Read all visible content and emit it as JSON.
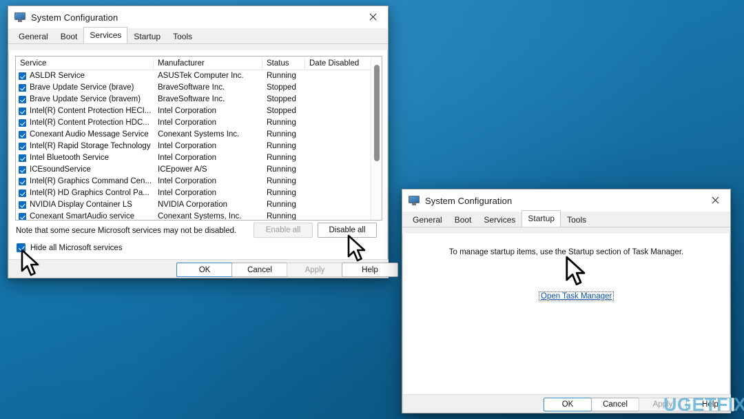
{
  "desktop": {
    "background_top": "#1d82bd",
    "background_bottom": "#0b5d8c"
  },
  "watermark": {
    "text": "UGETFIX"
  },
  "window_services": {
    "title": "System Configuration",
    "icon": "monitor-icon",
    "close_label": "✕",
    "tabs": [
      {
        "label": "General",
        "active": false
      },
      {
        "label": "Boot",
        "active": false
      },
      {
        "label": "Services",
        "active": true
      },
      {
        "label": "Startup",
        "active": false
      },
      {
        "label": "Tools",
        "active": false
      }
    ],
    "columns": [
      "Service",
      "Manufacturer",
      "Status",
      "Date Disabled"
    ],
    "rows": [
      {
        "checked": true,
        "service": "ASLDR Service",
        "manufacturer": "ASUSTek Computer Inc.",
        "status": "Running",
        "date_disabled": ""
      },
      {
        "checked": true,
        "service": "Brave Update Service (brave)",
        "manufacturer": "BraveSoftware Inc.",
        "status": "Stopped",
        "date_disabled": ""
      },
      {
        "checked": true,
        "service": "Brave Update Service (bravem)",
        "manufacturer": "BraveSoftware Inc.",
        "status": "Stopped",
        "date_disabled": ""
      },
      {
        "checked": true,
        "service": "Intel(R) Content Protection HECI...",
        "manufacturer": "Intel Corporation",
        "status": "Stopped",
        "date_disabled": ""
      },
      {
        "checked": true,
        "service": "Intel(R) Content Protection HDC...",
        "manufacturer": "Intel Corporation",
        "status": "Running",
        "date_disabled": ""
      },
      {
        "checked": true,
        "service": "Conexant Audio Message Service",
        "manufacturer": "Conexant Systems Inc.",
        "status": "Running",
        "date_disabled": ""
      },
      {
        "checked": true,
        "service": "Intel(R) Rapid Storage Technology",
        "manufacturer": "Intel Corporation",
        "status": "Running",
        "date_disabled": ""
      },
      {
        "checked": true,
        "service": "Intel Bluetooth Service",
        "manufacturer": "Intel Corporation",
        "status": "Running",
        "date_disabled": ""
      },
      {
        "checked": true,
        "service": "ICEsoundService",
        "manufacturer": "ICEpower A/S",
        "status": "Running",
        "date_disabled": ""
      },
      {
        "checked": true,
        "service": "Intel(R) Graphics Command Cen...",
        "manufacturer": "Intel Corporation",
        "status": "Running",
        "date_disabled": ""
      },
      {
        "checked": true,
        "service": "Intel(R) HD Graphics Control Pa...",
        "manufacturer": "Intel Corporation",
        "status": "Running",
        "date_disabled": ""
      },
      {
        "checked": true,
        "service": "NVIDIA Display Container LS",
        "manufacturer": "NVIDIA Corporation",
        "status": "Running",
        "date_disabled": ""
      },
      {
        "checked": true,
        "service": "Conexant SmartAudio service",
        "manufacturer": "Conexant Systems, Inc.",
        "status": "Running",
        "date_disabled": ""
      }
    ],
    "note": "Note that some secure Microsoft services may not be disabled.",
    "hide_microsoft": {
      "label": "Hide all Microsoft services",
      "checked": true
    },
    "enable_all": {
      "label": "Enable all",
      "enabled": false
    },
    "disable_all": {
      "label": "Disable all",
      "enabled": true
    },
    "footer_buttons": [
      {
        "label": "OK",
        "enabled": true,
        "default": true
      },
      {
        "label": "Cancel",
        "enabled": true,
        "default": false
      },
      {
        "label": "Apply",
        "enabled": false,
        "default": false
      },
      {
        "label": "Help",
        "enabled": true,
        "default": false
      }
    ]
  },
  "window_startup": {
    "title": "System Configuration",
    "icon": "monitor-icon",
    "close_label": "✕",
    "tabs": [
      {
        "label": "General",
        "active": false
      },
      {
        "label": "Boot",
        "active": false
      },
      {
        "label": "Services",
        "active": false
      },
      {
        "label": "Startup",
        "active": true
      },
      {
        "label": "Tools",
        "active": false
      }
    ],
    "note": "To manage startup items, use the Startup section of Task Manager.",
    "link_label": "Open Task Manager",
    "footer_buttons": [
      {
        "label": "OK",
        "enabled": true,
        "default": true
      },
      {
        "label": "Cancel",
        "enabled": true,
        "default": false
      },
      {
        "label": "Apply",
        "enabled": false,
        "default": false
      },
      {
        "label": "Help",
        "enabled": true,
        "default": false
      }
    ]
  }
}
